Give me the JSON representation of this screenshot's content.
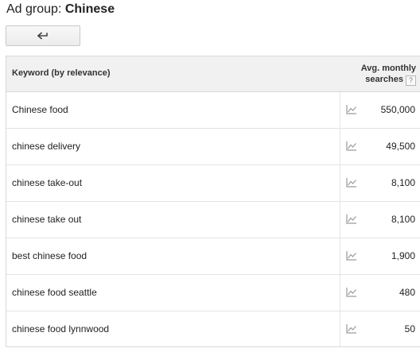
{
  "header": {
    "prefix": "Ad group:",
    "ad_group_name": "Chinese"
  },
  "back_button": {
    "icon": "back-arrow-icon"
  },
  "table": {
    "col_keyword": "Keyword (by relevance)",
    "col_searches_line1": "Avg. monthly",
    "col_searches_line2": "searches",
    "help_symbol": "?",
    "trend_icon": "line-chart-icon",
    "rows": [
      {
        "keyword": "Chinese food",
        "searches": "550,000"
      },
      {
        "keyword": "chinese delivery",
        "searches": "49,500"
      },
      {
        "keyword": "chinese take-out",
        "searches": "8,100"
      },
      {
        "keyword": "chinese take out",
        "searches": "8,100"
      },
      {
        "keyword": "best chinese food",
        "searches": "1,900"
      },
      {
        "keyword": "chinese food seattle",
        "searches": "480"
      },
      {
        "keyword": "chinese food lynnwood",
        "searches": "50"
      }
    ]
  }
}
